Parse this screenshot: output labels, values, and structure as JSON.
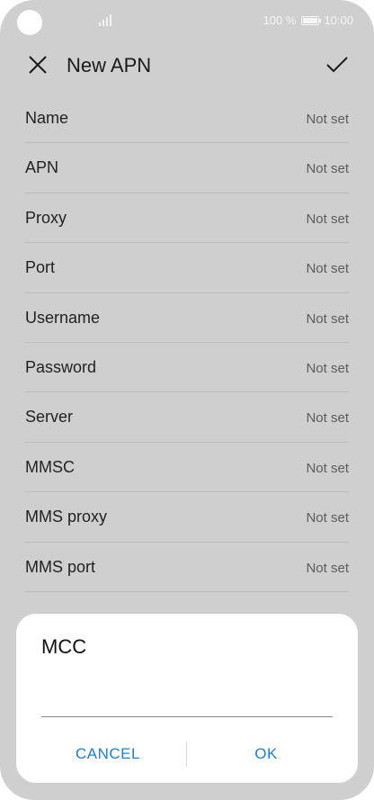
{
  "status_bar": {
    "battery_text": "100 %",
    "time": "10:00"
  },
  "header": {
    "title": "New APN",
    "close_icon": "close-icon",
    "confirm_icon": "check-icon"
  },
  "fields": [
    {
      "label": "Name",
      "value": "Not set"
    },
    {
      "label": "APN",
      "value": "Not set"
    },
    {
      "label": "Proxy",
      "value": "Not set"
    },
    {
      "label": "Port",
      "value": "Not set"
    },
    {
      "label": "Username",
      "value": "Not set"
    },
    {
      "label": "Password",
      "value": "Not set"
    },
    {
      "label": "Server",
      "value": "Not set"
    },
    {
      "label": "MMSC",
      "value": "Not set"
    },
    {
      "label": "MMS proxy",
      "value": "Not set"
    },
    {
      "label": "MMS port",
      "value": "Not set"
    }
  ],
  "dialog": {
    "title": "MCC",
    "input_value": "",
    "cancel_label": "CANCEL",
    "ok_label": "OK"
  },
  "colors": {
    "accent": "#1a7fd6",
    "scrim_background": "#cfcfcf",
    "dialog_background": "#ffffff"
  }
}
